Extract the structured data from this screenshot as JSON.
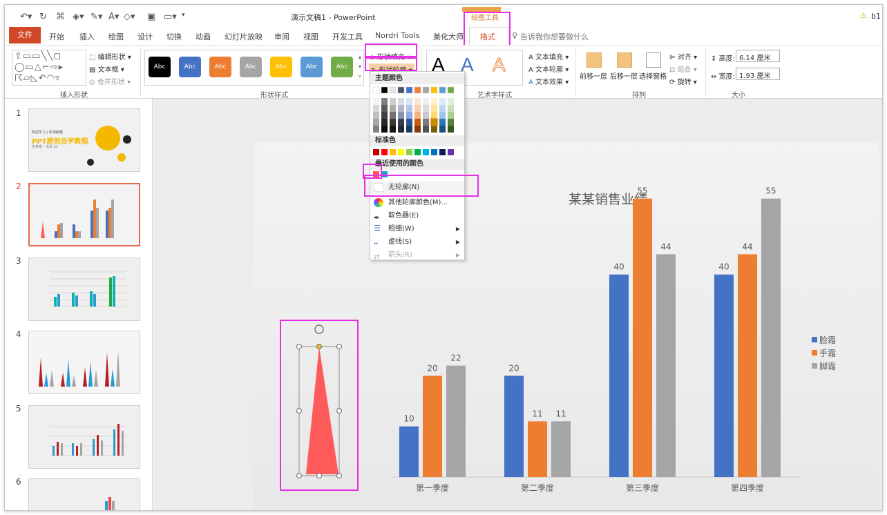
{
  "window": {
    "title": "演示文稿1 - PowerPoint",
    "user": "b1",
    "contextual_tab": "绘图工具"
  },
  "tabs": [
    "文件",
    "开始",
    "插入",
    "绘图",
    "设计",
    "切换",
    "动画",
    "幻灯片放映",
    "审阅",
    "视图",
    "开发工具",
    "Nordri Tools",
    "美化大师",
    "格式"
  ],
  "tell_me": "告诉我你想要做什么",
  "ribbon": {
    "insert_shapes": {
      "label": "插入形状",
      "edit_shape": "编辑形状",
      "text_box": "文本框",
      "merge": "合并形状"
    },
    "shape_styles": {
      "label": "形状样式",
      "buttons": [
        "Abc",
        "Abc",
        "Abc",
        "Abc",
        "Abc",
        "Abc",
        "Abc"
      ],
      "fill": "形状填充",
      "outline": "形状轮廓"
    },
    "wordart": {
      "label": "艺术字样式",
      "text_fill": "文本填充",
      "text_outline": "文本轮廓",
      "text_effects": "文本效果",
      "sample": "A"
    },
    "arrange": {
      "label": "排列",
      "forward": "前移一层",
      "backward": "后移一层",
      "selection": "选择窗格",
      "align": "对齐",
      "group": "组合",
      "rotate": "旋转"
    },
    "size": {
      "label": "大小",
      "height_label": "高度:",
      "height_value": "6.14 厘米",
      "width_label": "宽度:",
      "width_value": "1.93 厘米"
    }
  },
  "outline_menu": {
    "theme_colors": "主题颜色",
    "standard_colors": "标准色",
    "recent_colors": "最近使用的颜色",
    "no_outline": "无轮廓(N)",
    "more_colors": "其他轮廓颜色(M)...",
    "eyedropper": "取色器(E)",
    "weight": "粗细(W)",
    "dashes": "虚线(S)",
    "arrows": "箭头(R)"
  },
  "thumbnails": {
    "numbers": [
      "1",
      "2",
      "3",
      "4",
      "5",
      "6"
    ],
    "slide1_line1": "PPT原创自学教程",
    "slide1_line2": "简说学习 | 职场秘籍",
    "slide1_line3": "主讲者：文武 b1"
  },
  "chart_data": {
    "type": "bar",
    "title": "某某销售业绩",
    "categories": [
      "第一季度",
      "第二季度",
      "第三季度",
      "第四季度"
    ],
    "series": [
      {
        "name": "脸霜",
        "color": "#4472c4",
        "values": [
          10,
          20,
          40,
          40
        ]
      },
      {
        "name": "手霜",
        "color": "#ed7d31",
        "values": [
          20,
          11,
          55,
          44
        ]
      },
      {
        "name": "脚霜",
        "color": "#a5a5a5",
        "values": [
          22,
          11,
          44,
          55
        ]
      }
    ],
    "ylim": [
      0,
      60
    ],
    "legend": "right"
  }
}
